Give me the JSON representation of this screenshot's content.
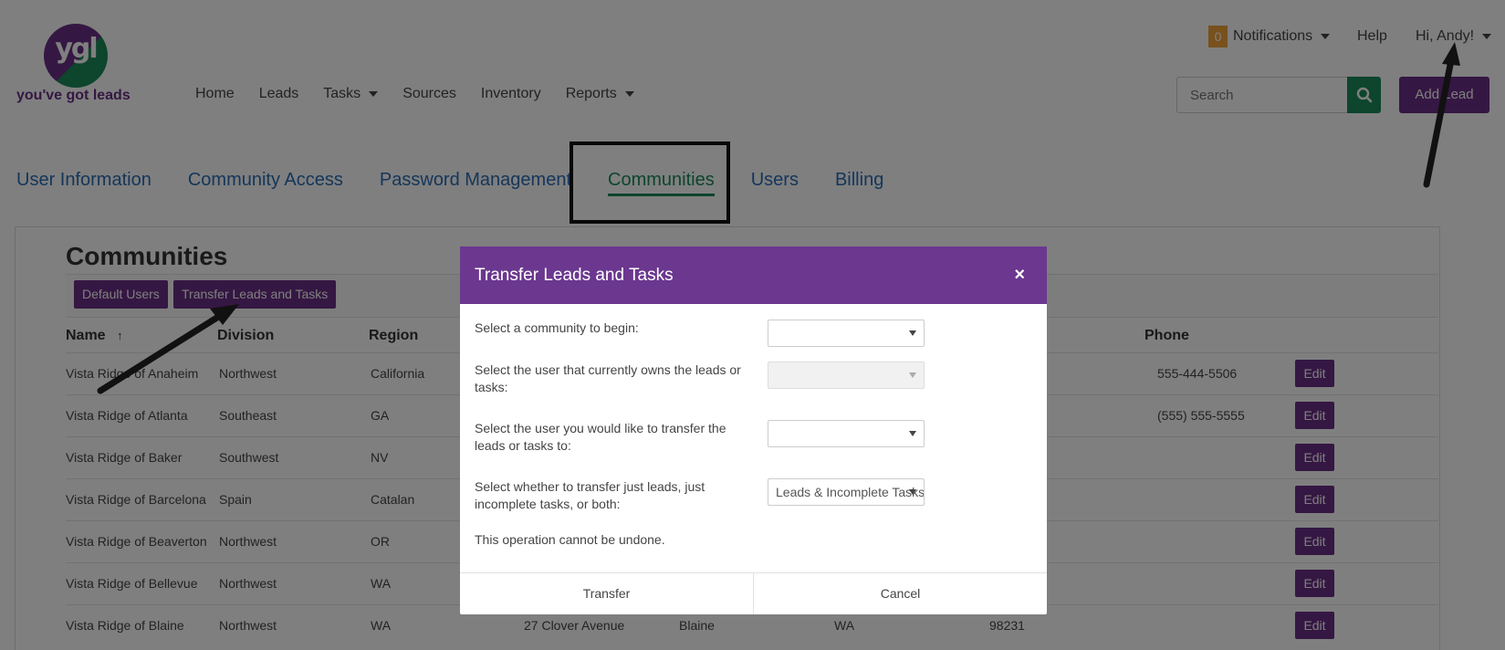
{
  "brand": {
    "logo_mark": "ygl",
    "logo_text": "you've got leads"
  },
  "nav": {
    "items": [
      {
        "label": "Home"
      },
      {
        "label": "Leads"
      },
      {
        "label": "Tasks"
      },
      {
        "label": "Sources"
      },
      {
        "label": "Inventory"
      },
      {
        "label": "Reports"
      }
    ]
  },
  "topbar": {
    "notifications_count": "0",
    "notifications_label": "Notifications",
    "help_label": "Help",
    "user_label": "Hi, Andy!"
  },
  "search": {
    "placeholder": "Search"
  },
  "add_lead_label": "Add Lead",
  "tabs": [
    {
      "label": "User Information"
    },
    {
      "label": "Community Access"
    },
    {
      "label": "Password Management"
    },
    {
      "label": "Communities"
    },
    {
      "label": "Users"
    },
    {
      "label": "Billing"
    }
  ],
  "panel": {
    "title": "Communities",
    "default_users_label": "Default Users",
    "transfer_label": "Transfer Leads and Tasks",
    "columns": {
      "name": "Name",
      "sort_glyph": "↑",
      "division": "Division",
      "region": "Region",
      "phone": "Phone"
    },
    "edit_label": "Edit",
    "rows": [
      {
        "name": "Vista Ridge of Anaheim",
        "division": "Northwest",
        "region": "California",
        "address": "",
        "city": "",
        "state": "",
        "zip": "",
        "phone": "555-444-5506"
      },
      {
        "name": "Vista Ridge of Atlanta",
        "division": "Southeast",
        "region": "GA",
        "address": "",
        "city": "",
        "state": "",
        "zip": "",
        "phone": "(555) 555-5555"
      },
      {
        "name": "Vista Ridge of Baker",
        "division": "Southwest",
        "region": "NV",
        "address": "",
        "city": "",
        "state": "",
        "zip": "",
        "phone": ""
      },
      {
        "name": "Vista Ridge of Barcelona",
        "division": "Spain",
        "region": "Catalan",
        "address": "",
        "city": "",
        "state": "",
        "zip": "",
        "phone": ""
      },
      {
        "name": "Vista Ridge of Beaverton",
        "division": "Northwest",
        "region": "OR",
        "address": "",
        "city": "",
        "state": "",
        "zip": "",
        "phone": ""
      },
      {
        "name": "Vista Ridge of Bellevue",
        "division": "Northwest",
        "region": "WA",
        "address": "",
        "city": "",
        "state": "",
        "zip": "",
        "phone": ""
      },
      {
        "name": "Vista Ridge of Blaine",
        "division": "Northwest",
        "region": "WA",
        "address": "27 Clover Avenue",
        "city": "Blaine",
        "state": "WA",
        "zip": "98231",
        "phone": ""
      }
    ]
  },
  "modal": {
    "title": "Transfer Leads and Tasks",
    "close_glyph": "×",
    "fields": [
      {
        "label": "Select a community to begin:",
        "value": ""
      },
      {
        "label": "Select the user that currently owns the leads or tasks:",
        "value": ""
      },
      {
        "label": "Select the user you would like to transfer the leads or tasks to:",
        "value": ""
      },
      {
        "label": "Select whether to transfer just leads, just incomplete tasks, or both:",
        "value": "Leads & Incomplete Tasks"
      }
    ],
    "warning": "This operation cannot be undone.",
    "transfer_label": "Transfer",
    "cancel_label": "Cancel"
  },
  "colors": {
    "brand_purple": "#6b2f86",
    "brand_green": "#1a8a5a",
    "link_blue": "#2a6db5",
    "badge_orange": "#f0a33a"
  },
  "icons": {
    "search": "search-icon",
    "close": "close-icon",
    "caret": "chevron-down-icon"
  }
}
